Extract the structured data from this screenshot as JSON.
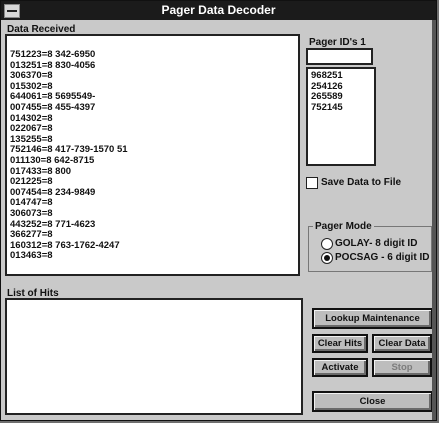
{
  "window": {
    "title": "Pager Data Decoder"
  },
  "data_received": {
    "label": "Data Received",
    "lines": [
      "751223=8 342-6950",
      "013251=8 830-4056",
      "306370=8",
      "015302=8",
      "644061=8 5695549-",
      "007455=8 455-4397",
      "014302=8",
      "022067=8",
      "135255=8",
      "752146=8 417-739-1570 51",
      "011130=8 642-8715",
      "017433=8 800",
      "021225=8",
      "007454=8 234-9849",
      "014747=8",
      "306073=8",
      "443252=8 771-4623",
      "366277=8",
      "160312=8 763-1762-4247",
      "013463=8"
    ]
  },
  "pager_ids": {
    "label": "Pager ID's 1",
    "input_value": "",
    "items": [
      "968251",
      "254126",
      "265589",
      "752145"
    ]
  },
  "save_data": {
    "label": "Save Data to File",
    "checked": false
  },
  "pager_mode": {
    "label": "Pager Mode",
    "options": [
      {
        "label": "GOLAY- 8 digit ID",
        "checked": false
      },
      {
        "label": "POCSAG - 6 digit ID",
        "checked": true
      }
    ]
  },
  "list_of_hits": {
    "label": "List of Hits",
    "items": []
  },
  "buttons": {
    "maintenance": "Lookup Maintenance",
    "clear_hits": "Clear Hits",
    "clear_data": "Clear Data",
    "activate": "Activate",
    "stop": "Stop",
    "close": "Close"
  }
}
